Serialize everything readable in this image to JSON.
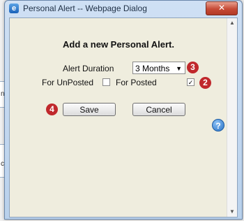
{
  "window": {
    "title": "Personal Alert -- Webpage Dialog",
    "close_glyph": "✕"
  },
  "dialog": {
    "heading": "Add a new Personal Alert.",
    "alert_duration_label": "Alert Duration",
    "alert_duration_value": "3 Months",
    "for_unposted_label": "For UnPosted",
    "for_unposted_checked": false,
    "for_posted_label": "For Posted",
    "for_posted_checked": true,
    "save_label": "Save",
    "cancel_label": "Cancel",
    "help_glyph": "?"
  },
  "annotations": {
    "badge_2": "2",
    "badge_3": "3",
    "badge_4": "4"
  },
  "background": {
    "char_1": "na",
    "char_2": "c"
  },
  "colors": {
    "badge": "#c0282c",
    "client_bg": "#efedde",
    "close_button": "#c64a36"
  }
}
